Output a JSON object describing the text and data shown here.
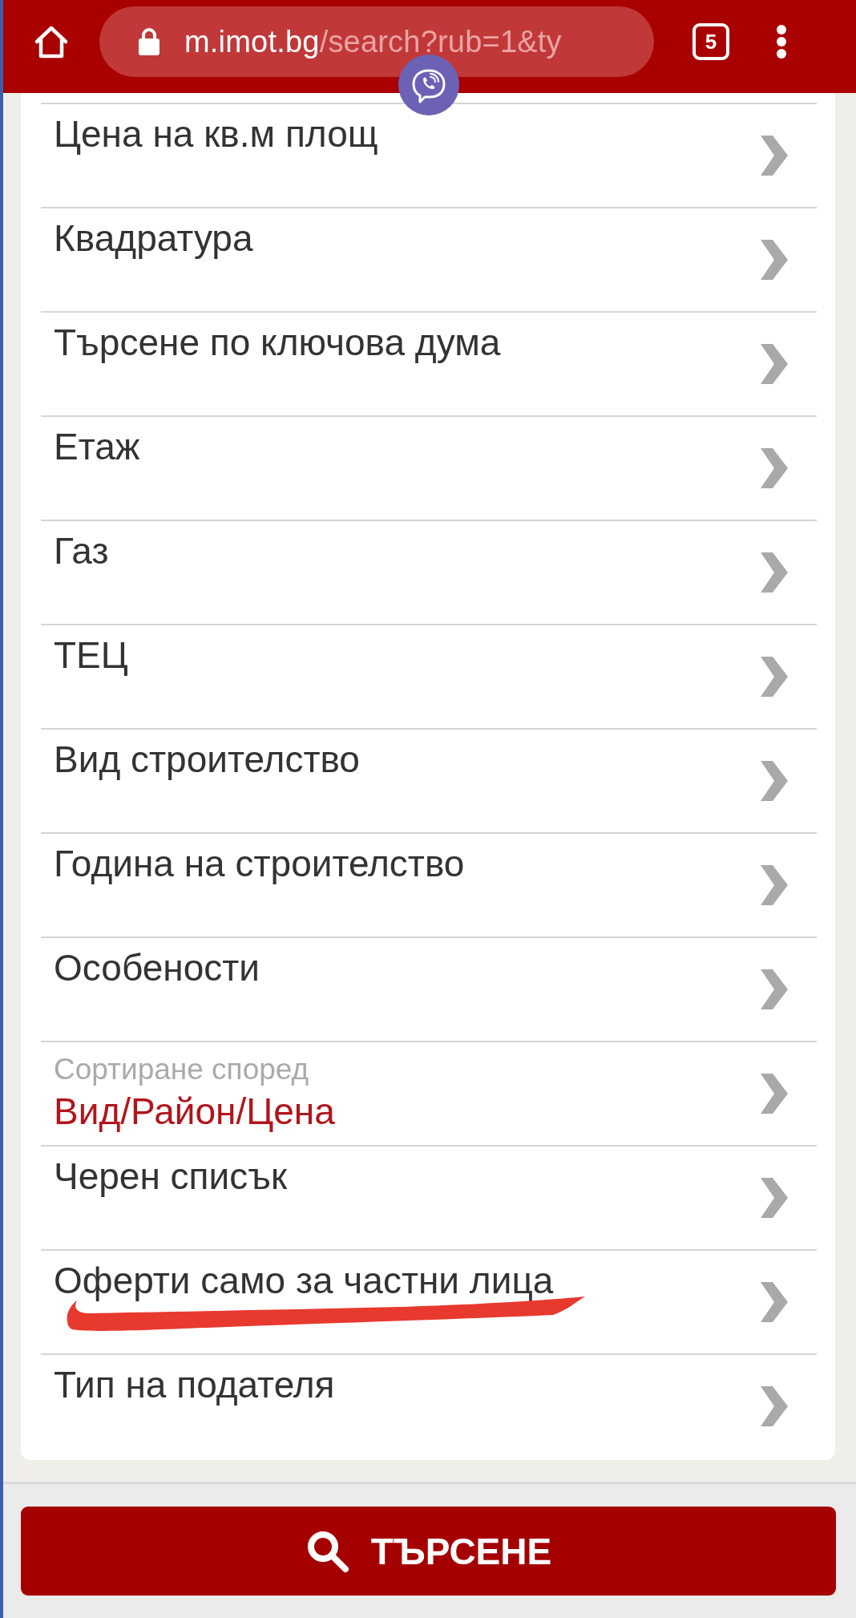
{
  "browser_bar": {
    "url_host": "m.imot.bg",
    "url_path": "/search?rub=1&ty",
    "tab_count": "5"
  },
  "filters": [
    {
      "kind": "plain",
      "label": "Цена на кв.м площ",
      "underlined": false
    },
    {
      "kind": "plain",
      "label": "Квадратура",
      "underlined": false
    },
    {
      "kind": "plain",
      "label": "Търсене по ключова дума",
      "underlined": false
    },
    {
      "kind": "plain",
      "label": "Етаж",
      "underlined": false
    },
    {
      "kind": "plain",
      "label": "Газ",
      "underlined": false
    },
    {
      "kind": "plain",
      "label": "ТЕЦ",
      "underlined": false
    },
    {
      "kind": "plain",
      "label": "Вид строителство",
      "underlined": false
    },
    {
      "kind": "plain",
      "label": "Година на строителство",
      "underlined": false
    },
    {
      "kind": "plain",
      "label": "Особености",
      "underlined": false
    },
    {
      "kind": "value",
      "label": "Сортиране според",
      "value": "Вид/Район/Цена",
      "underlined": false
    },
    {
      "kind": "plain",
      "label": "Черен списък",
      "underlined": false
    },
    {
      "kind": "plain",
      "label": "Оферти само за частни лица",
      "underlined": true
    },
    {
      "kind": "plain",
      "label": "Тип на подателя",
      "underlined": false
    }
  ],
  "search_button": {
    "label": "ТЪРСЕНЕ"
  }
}
